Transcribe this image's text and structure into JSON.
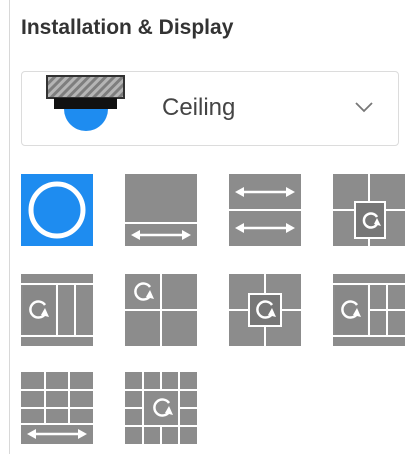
{
  "panel": {
    "title": "Installation & Display"
  },
  "mount": {
    "selected": "Ceiling",
    "icon": "ceiling-dome-camera-icon"
  },
  "display_modes": {
    "selected_index": 0,
    "selected_color": "#1e8cf0",
    "tile_color": "#8c8c8c",
    "modes": [
      {
        "icon": "fisheye-original-icon"
      },
      {
        "icon": "panorama-icon"
      },
      {
        "icon": "dual-panorama-icon"
      },
      {
        "icon": "panorama-three-ptz-icon"
      },
      {
        "icon": "fisheye-three-ptz-icon"
      },
      {
        "icon": "fisheye-quad-ptz-icon"
      },
      {
        "icon": "quad-ptz-center-fisheye-icon"
      },
      {
        "icon": "fisheye-six-ptz-icon"
      },
      {
        "icon": "panorama-six-ptz-icon"
      },
      {
        "icon": "fisheye-eight-ptz-icon"
      }
    ]
  }
}
